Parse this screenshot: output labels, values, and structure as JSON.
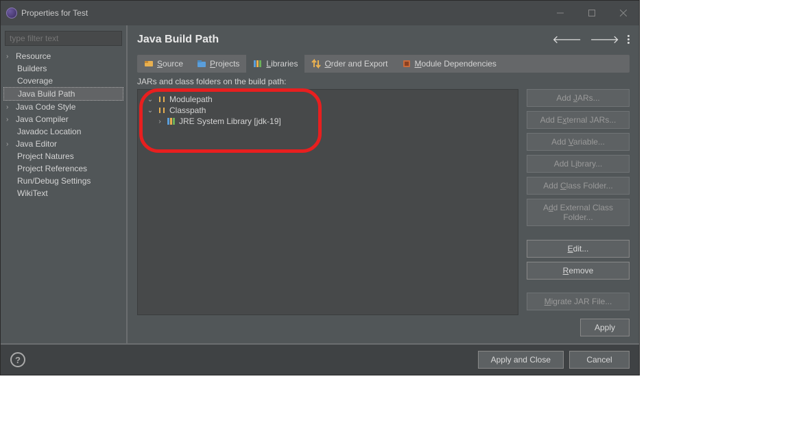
{
  "window": {
    "title": "Properties for Test"
  },
  "filter": {
    "placeholder": "type filter text"
  },
  "sidebar": {
    "items": [
      {
        "label": "Resource",
        "expandable": true
      },
      {
        "label": "Builders",
        "expandable": false
      },
      {
        "label": "Coverage",
        "expandable": false
      },
      {
        "label": "Java Build Path",
        "expandable": false,
        "selected": true
      },
      {
        "label": "Java Code Style",
        "expandable": true
      },
      {
        "label": "Java Compiler",
        "expandable": true
      },
      {
        "label": "Javadoc Location",
        "expandable": false
      },
      {
        "label": "Java Editor",
        "expandable": true
      },
      {
        "label": "Project Natures",
        "expandable": false
      },
      {
        "label": "Project References",
        "expandable": false
      },
      {
        "label": "Run/Debug Settings",
        "expandable": false
      },
      {
        "label": "WikiText",
        "expandable": false
      }
    ]
  },
  "page": {
    "title": "Java Build Path",
    "tabs": [
      {
        "icon": "source-icon",
        "prefix": "",
        "hotkey": "S",
        "suffix": "ource"
      },
      {
        "icon": "projects-icon",
        "prefix": "",
        "hotkey": "P",
        "suffix": "rojects"
      },
      {
        "icon": "libraries-icon",
        "prefix": "",
        "hotkey": "L",
        "suffix": "ibraries",
        "active": true
      },
      {
        "icon": "order-export-icon",
        "prefix": "",
        "hotkey": "O",
        "suffix": "rder and Export"
      },
      {
        "icon": "module-deps-icon",
        "prefix": "",
        "hotkey": "M",
        "suffix": "odule Dependencies"
      }
    ],
    "description": "JARs and class folders on the build path:"
  },
  "libTree": {
    "modulepath": "Modulepath",
    "classpath": "Classpath",
    "jre": "JRE System Library [jdk-19]"
  },
  "buttons": {
    "addJars": {
      "pre": "Add ",
      "hot": "J",
      "post": "ARs..."
    },
    "addExternalJars": {
      "pre": "Add E",
      "hot": "x",
      "post": "ternal JARs..."
    },
    "addVariable": {
      "pre": "Add ",
      "hot": "V",
      "post": "ariable..."
    },
    "addLibrary": {
      "pre": "Add L",
      "hot": "i",
      "post": "brary..."
    },
    "addClassFolder": {
      "pre": "Add ",
      "hot": "C",
      "post": "lass Folder..."
    },
    "addExtClassFolder": {
      "pre": "A",
      "hot": "d",
      "post": "d External Class Folder..."
    },
    "edit": {
      "pre": "",
      "hot": "E",
      "post": "dit..."
    },
    "remove": {
      "pre": "",
      "hot": "R",
      "post": "emove"
    },
    "migrate": {
      "pre": "",
      "hot": "M",
      "post": "igrate JAR File..."
    }
  },
  "actions": {
    "apply": "Apply",
    "applyClose": "Apply and Close",
    "cancel": "Cancel"
  }
}
